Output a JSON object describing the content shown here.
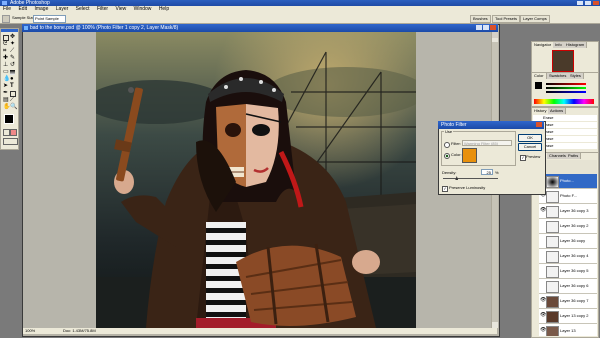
{
  "app": {
    "title": "Adobe Photoshop"
  },
  "menu": [
    "File",
    "Edit",
    "Image",
    "Layer",
    "Select",
    "Filter",
    "View",
    "Window",
    "Help"
  ],
  "options_bar": {
    "sample_size_label": "Sample Size:",
    "sample_size_value": "Point Sample",
    "tabs": [
      "Brushes",
      "Tool Presets",
      "Layer Comps"
    ]
  },
  "document": {
    "title": "bad to the bone.psd @ 100% (Photo Filter 1 copy 2, Layer Mask/8)",
    "status_zoom": "100%",
    "status_doc": "Doc: 1.43M/75.8M"
  },
  "navigator": {
    "tabs": [
      "Navigator",
      "Info",
      "Histogram"
    ]
  },
  "color_palette": {
    "tabs": [
      "Color",
      "Swatches",
      "Styles"
    ]
  },
  "history": {
    "tabs": [
      "History",
      "Actions"
    ],
    "items": [
      "",
      "Erase",
      "Erase",
      "Erase",
      "Erase",
      "Erase"
    ]
  },
  "layers_palette": {
    "tabs": [
      "Layers",
      "Channels",
      "Paths"
    ],
    "layers": [
      {
        "name": "Photo...",
        "selected": true
      },
      {
        "name": "Photo F...",
        "selected": false
      },
      {
        "name": "Layer 36 copy 3",
        "selected": false
      },
      {
        "name": "Layer 36 copy 2",
        "selected": false
      },
      {
        "name": "Layer 36 copy",
        "selected": false
      },
      {
        "name": "Layer 36 copy 4",
        "selected": false
      },
      {
        "name": "Layer 36 copy 5",
        "selected": false
      },
      {
        "name": "Layer 36 copy 6",
        "selected": false
      },
      {
        "name": "Layer 36 copy 7",
        "selected": false
      },
      {
        "name": "Layer 13 copy 2",
        "selected": false
      },
      {
        "name": "Layer 13",
        "selected": false
      }
    ]
  },
  "photo_filter_dialog": {
    "title": "Photo Filter",
    "use_label": "Use",
    "filter_label": "Filter:",
    "filter_value": "Warming Filter (85)",
    "color_label": "Color:",
    "color_swatch": "#e8900c",
    "density_label": "Density:",
    "density_value": "25",
    "density_unit": "%",
    "density_level": 25,
    "preserve_label": "Preserve Luminosity",
    "ok_label": "OK",
    "cancel_label": "Cancel",
    "preview_label": "Preview"
  }
}
